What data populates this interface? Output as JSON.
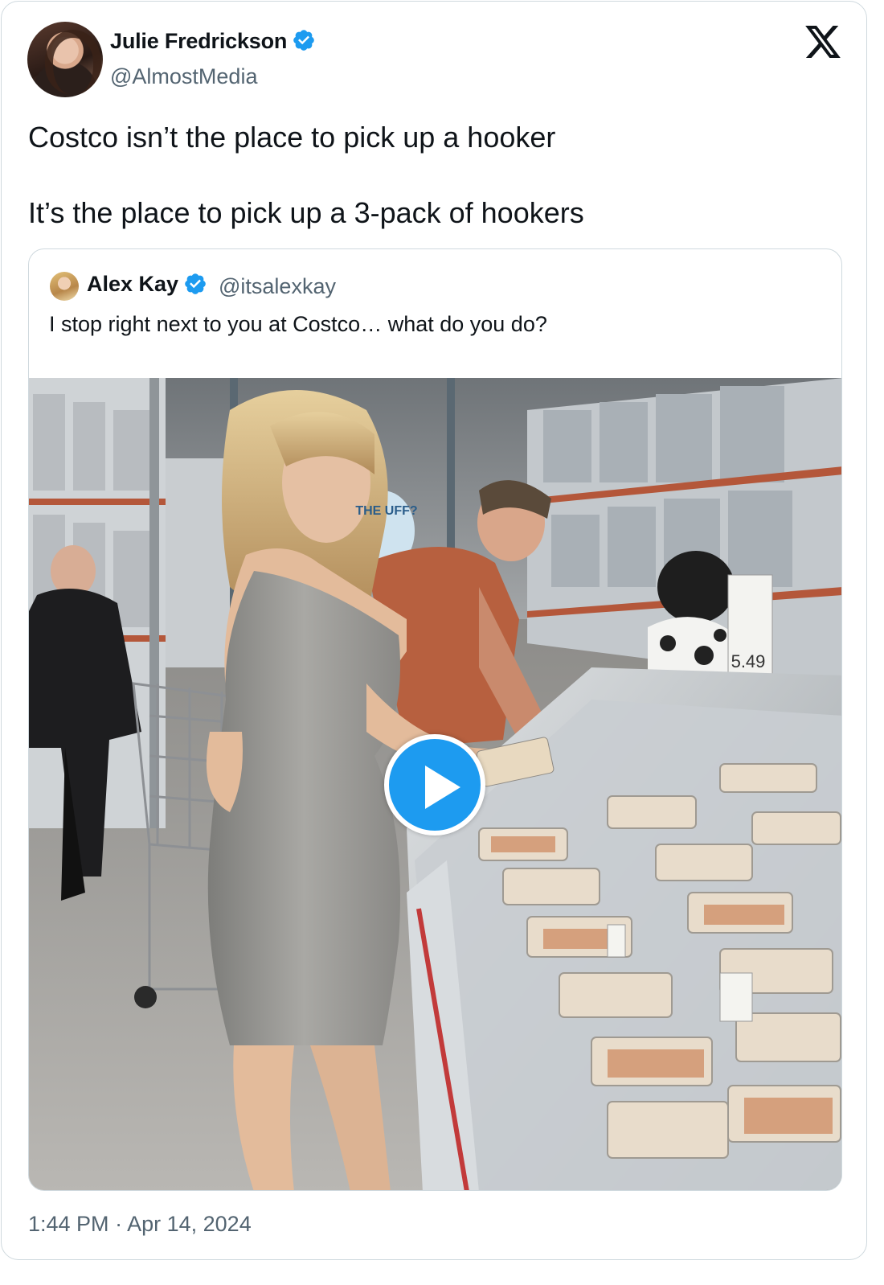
{
  "tweet": {
    "author": {
      "name": "Julie Fredrickson",
      "handle": "@AlmostMedia",
      "verified": true
    },
    "text_lines": [
      "Costco isn’t the place to pick up a hooker",
      "It’s the place to pick up a 3-pack of hookers"
    ],
    "time": "1:44 PM",
    "separator": "·",
    "date": "Apr 14, 2024"
  },
  "quoted_tweet": {
    "author": {
      "name": "Alex Kay",
      "handle": "@itsalexkay",
      "verified": true
    },
    "text": "I stop right next to you at Costco… what do you do?",
    "media": {
      "type": "video",
      "play_icon": "play-icon",
      "visible_sign_text": "THE UFF?",
      "visible_price_tag": "5.49"
    }
  },
  "branding": {
    "logo_icon": "x-logo-icon"
  },
  "colors": {
    "accent": "#1d9bf0",
    "text_primary": "#0f1419",
    "text_secondary": "#536471",
    "border": "#cfd9de"
  }
}
